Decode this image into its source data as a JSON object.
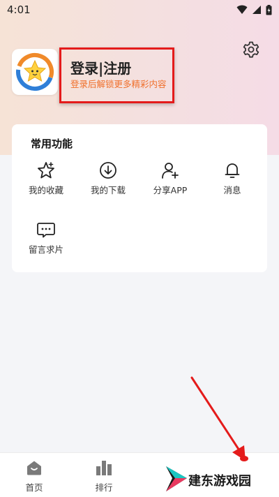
{
  "status_bar": {
    "time": "4:01"
  },
  "profile": {
    "title": "登录|注册",
    "subtitle": "登录后解锁更多精彩内容"
  },
  "common_functions": {
    "title": "常用功能",
    "items": [
      {
        "label": "我的收藏",
        "icon": "star-icon"
      },
      {
        "label": "我的下载",
        "icon": "download-icon"
      },
      {
        "label": "分享APP",
        "icon": "share-user-icon"
      },
      {
        "label": "消息",
        "icon": "bell-icon"
      },
      {
        "label": "留言求片",
        "icon": "message-icon"
      }
    ]
  },
  "tabs": [
    {
      "label": "首页",
      "icon": "home-icon"
    },
    {
      "label": "排行",
      "icon": "ranking-icon"
    }
  ],
  "watermark": {
    "text": "建东游戏园"
  },
  "colors": {
    "accent_orange": "#f0702c",
    "annotation_red": "#e41b1b"
  }
}
